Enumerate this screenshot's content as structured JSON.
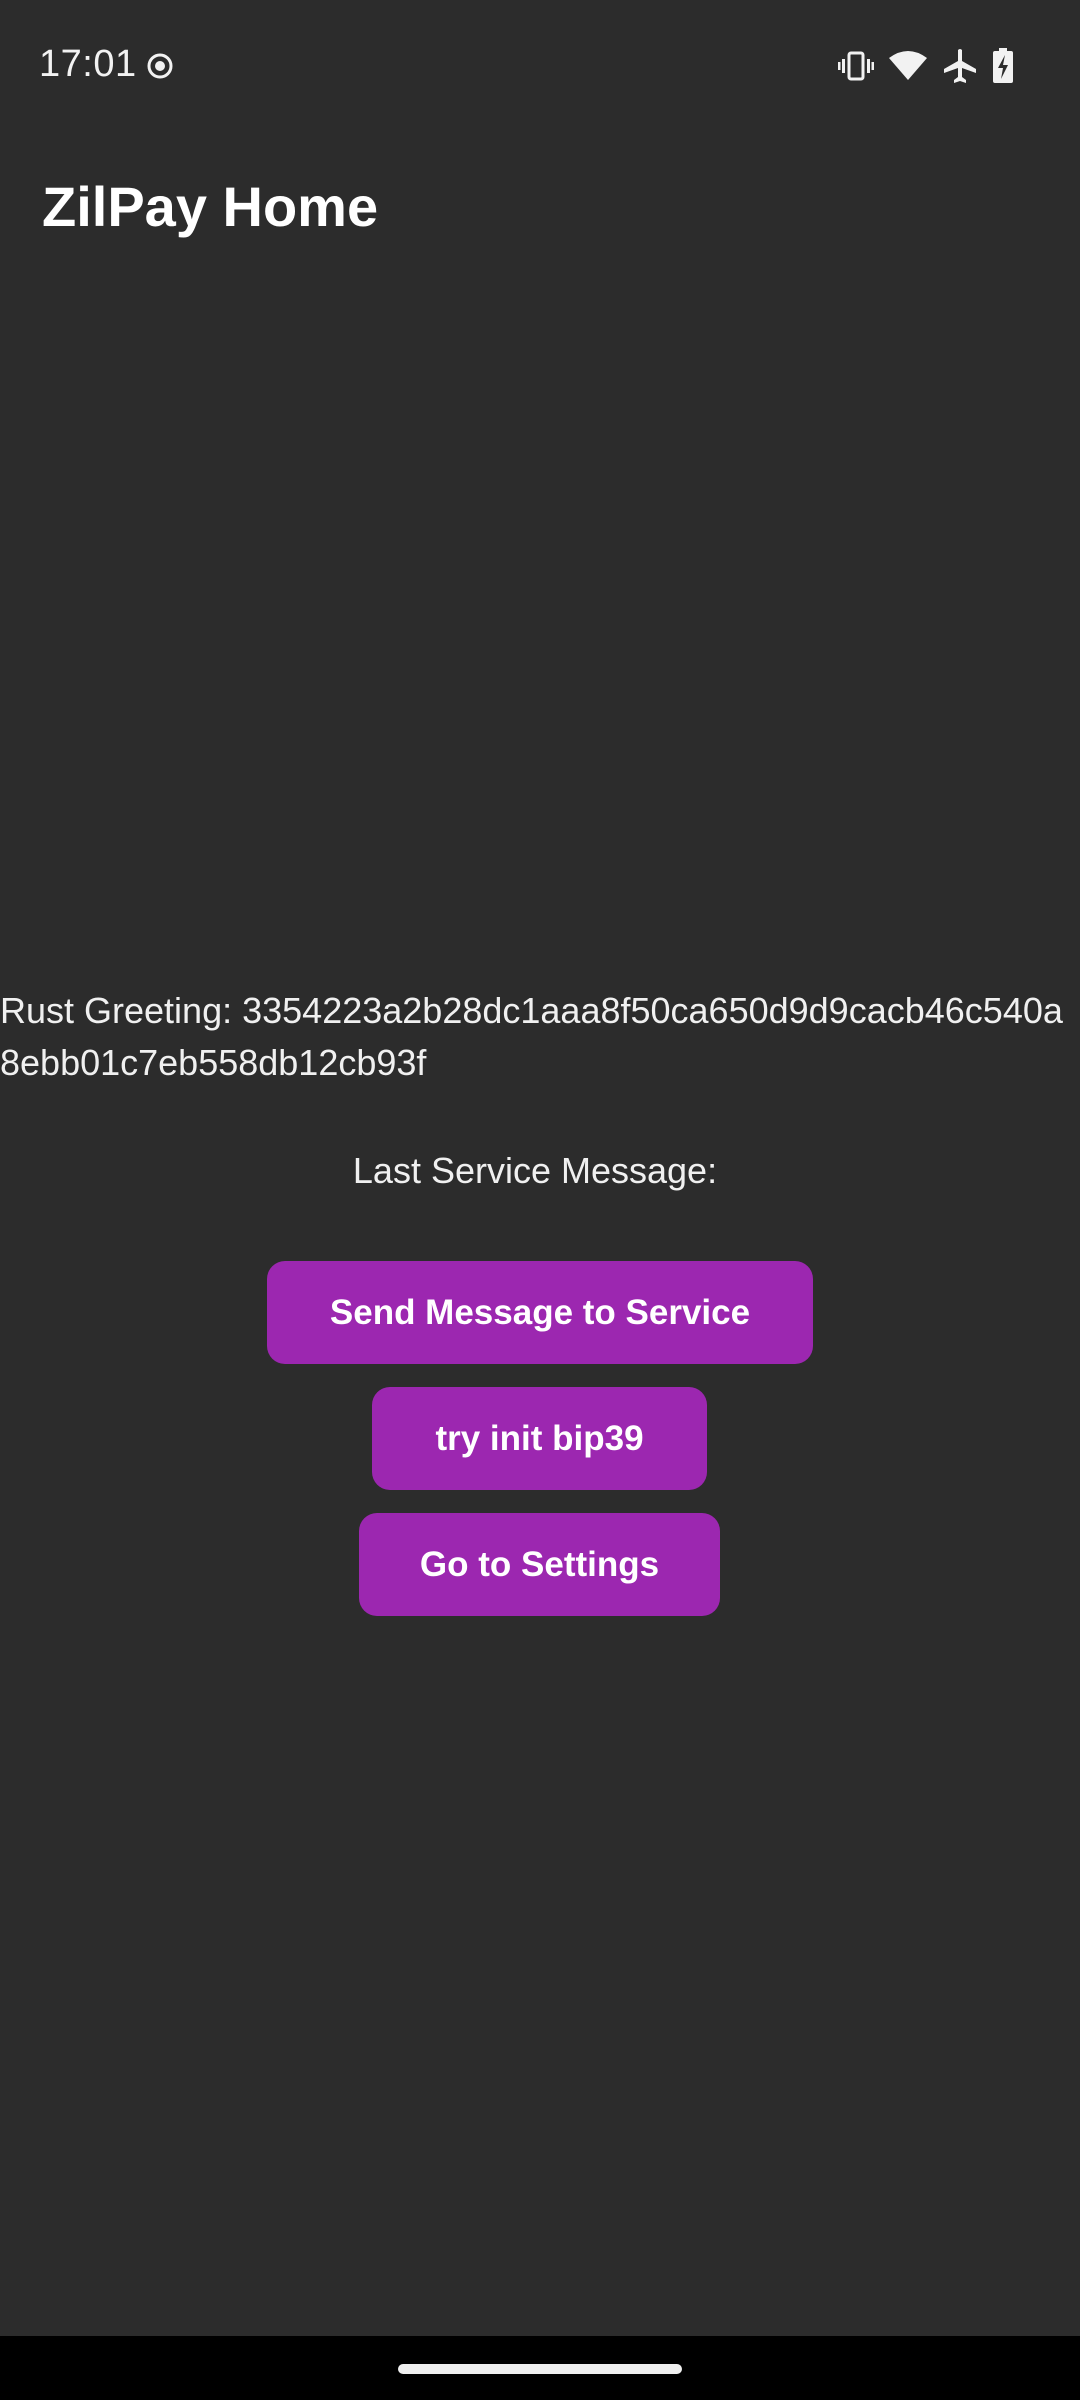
{
  "status_bar": {
    "time": "17:01",
    "left_icons": [
      "record-icon"
    ],
    "right_icons": [
      "vibrate-icon",
      "wifi-icon",
      "airplane-mode-icon",
      "battery-charging-icon"
    ]
  },
  "app_bar": {
    "title": "ZilPay Home"
  },
  "main": {
    "greeting": "Rust Greeting: 3354223a2b28dc1aaa8f50ca650d9d9cacb46c540a8ebb01c7eb558db12cb93f",
    "last_message": "Last Service Message:",
    "buttons": {
      "send": "Send Message to Service",
      "bip39": "try init bip39",
      "settings": "Go to Settings"
    }
  },
  "colors": {
    "background": "#2c2c2c",
    "button": "#9c27b0",
    "text": "#ffffff",
    "nav_bar": "#000000"
  }
}
